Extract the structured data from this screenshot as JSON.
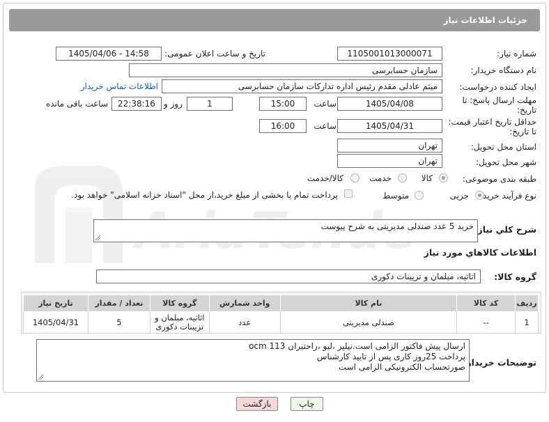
{
  "header": {
    "title": "جزئیات اطلاعات نیاز"
  },
  "labels": {
    "need_number": "شماره نیاز:",
    "announce_datetime": "تاریخ و ساعت اعلان عمومی:",
    "buyer_org": "نام دستگاه خریدار:",
    "requester": "ایجاد کننده درخواست:",
    "reply_deadline_1": "مهلت ارسال پاسخ: تا",
    "reply_deadline_2": "تاریخ:",
    "price_valid_1": "حداقل تاریخ اعتبار قیمت:",
    "price_valid_2": "تا تاریخ:",
    "province": "استان محل تحویل:",
    "city": "شهر محل تحویل:",
    "category": "طبقه بندی موضوعی:",
    "process_type": "نوع فرآیند خرید :",
    "hour": "ساعت",
    "day_and": "روز و",
    "remaining": "ساعت باقی مانده",
    "need_summary": "شرح کلي نياز:",
    "goods_info": "اطلاعات کالاهاي مورد نياز",
    "goods_group": "گروه کالا:",
    "buyer_notes": "توضیحات خریدار:"
  },
  "values": {
    "need_number": "1105001013000071",
    "announce_datetime": "1405/04/06 - 14:58",
    "buyer_org": "سازمان حسابرسی",
    "requester": "میثم عادلی مقدم رئیس اداره تدارکات سازمان حسابرسی",
    "contact_link": "اطلاعات تماس خریدار",
    "reply_date": "1405/04/08",
    "reply_time": "15:00",
    "reply_days": "1",
    "reply_remaining": "22:38:16",
    "price_date": "1405/04/31",
    "price_time": "16:00",
    "province": "تهران",
    "city": "تهران",
    "need_summary": "خرید 5 عدد صندلی مدیریتی به شرح پیوست",
    "goods_group": "اثاثیه، مبلمان و تزیینات دکوری"
  },
  "category_options": [
    "کالا",
    "خدمت",
    "کالا/خدمت"
  ],
  "process_options": [
    "جزیی",
    "متوسط"
  ],
  "payment_note": "پرداخت تمام یا بخشی از مبلغ خرید،از محل \"اسناد خزانه اسلامی\" خواهد بود.",
  "table": {
    "headers": [
      "ردیف",
      "کد کالا",
      "نام کالا",
      "واحد شمارش",
      "گروه کالا",
      "تعداد / مقدار",
      "تاریخ نیاز"
    ],
    "rows": [
      [
        "1",
        "--",
        "صندلی مدیریتی",
        "عدد",
        "اثاثیه، مبلمان و تزیینات دکوری",
        "5",
        "1405/04/31"
      ]
    ]
  },
  "notes": [
    "ارسال پیش فاکتور الزامی است.نیلپر ،لیو ،راحتیران ocm 113",
    "پرداخت 25روز کاری پس از تایید کارشناس",
    "صورتحساب الکترونیکی الزامی است"
  ],
  "buttons": {
    "print": "چاپ",
    "back": "بازگشت"
  },
  "watermark": {
    "text": "AriaTender.net"
  },
  "colors": {
    "header_bg": "#9a9a9a",
    "link": "#1d5fa7",
    "back_button": "#f7d9d9",
    "print_button": "#eef7ea"
  }
}
